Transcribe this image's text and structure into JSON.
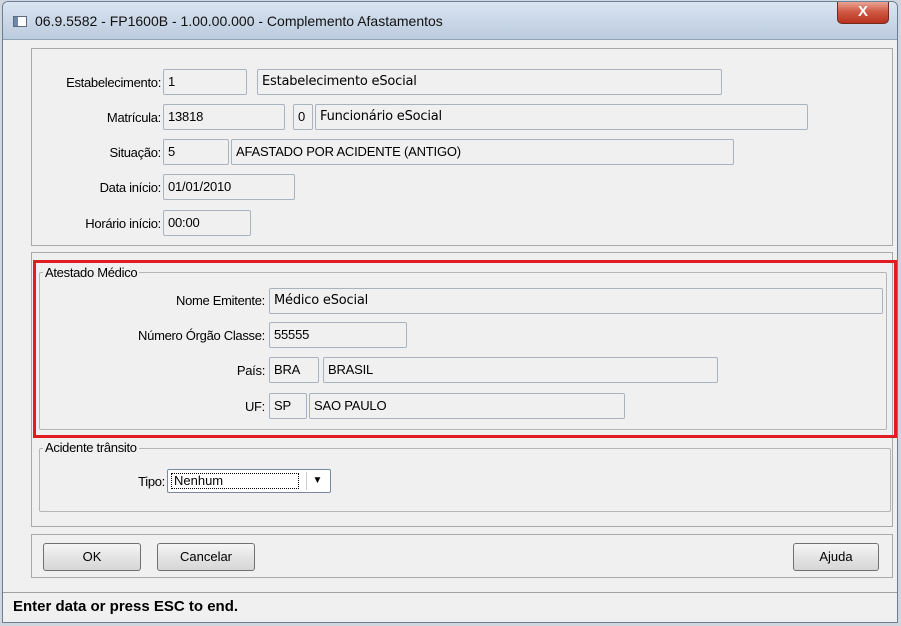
{
  "window": {
    "title": "06.9.5582 - FP1600B - 1.00.00.000 - Complemento Afastamentos",
    "close_glyph": "X"
  },
  "main": {
    "estabelecimento_label": "Estabelecimento:",
    "estabelecimento_code": "1",
    "estabelecimento_name": "Estabelecimento eSocial",
    "matricula_label": "Matrícula:",
    "matricula_code": "13818",
    "matricula_digit": "0",
    "matricula_name": "Funcionário eSocial",
    "situacao_label": "Situação:",
    "situacao_code": "5",
    "situacao_desc": "AFASTADO POR ACIDENTE (ANTIGO)",
    "data_inicio_label": "Data início:",
    "data_inicio_value": "01/01/2010",
    "horario_inicio_label": "Horário início:",
    "horario_inicio_value": "00:00"
  },
  "atestado": {
    "legend": "Atestado Médico",
    "nome_emitente_label": "Nome Emitente:",
    "nome_emitente_value": "Médico eSocial",
    "numero_orgao_label": "Número Órgão Classe:",
    "numero_orgao_value": "55555",
    "pais_label": "País:",
    "pais_code": "BRA",
    "pais_name": "BRASIL",
    "uf_label": "UF:",
    "uf_code": "SP",
    "uf_name": "SAO PAULO",
    "highlight_color": "#e31b23"
  },
  "acidente": {
    "legend": "Acidente trânsito",
    "tipo_label": "Tipo:",
    "tipo_value": "Nenhum"
  },
  "buttons": {
    "ok": "OK",
    "cancelar": "Cancelar",
    "ajuda": "Ajuda"
  },
  "status": {
    "message": "Enter data or press ESC to end."
  }
}
